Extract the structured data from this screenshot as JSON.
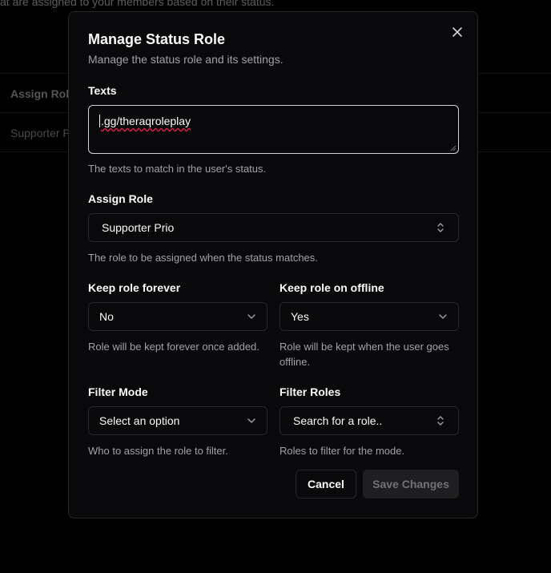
{
  "background": {
    "description_text": "at are assigned to your members based on their status.",
    "column_header": "Assign Role",
    "row_value": "Supporter P"
  },
  "modal": {
    "title": "Manage Status Role",
    "subtitle": "Manage the status role and its settings.",
    "close_icon": "x-icon",
    "texts": {
      "label": "Texts",
      "value": ".gg/theraqroleplay",
      "help": "The texts to match in the user's status."
    },
    "assign_role": {
      "label": "Assign Role",
      "value": "Supporter Prio",
      "help": "The role to be assigned when the status matches.",
      "icon": "chevrons-up-down-icon"
    },
    "keep_forever": {
      "label": "Keep role forever",
      "value": "No",
      "help": "Role will be kept forever once added.",
      "icon": "chevron-down-icon"
    },
    "keep_offline": {
      "label": "Keep role on offline",
      "value": "Yes",
      "help": "Role will be kept when the user goes offline.",
      "icon": "chevron-down-icon"
    },
    "filter_mode": {
      "label": "Filter Mode",
      "value": "Select an option",
      "help": "Who to assign the role to filter.",
      "icon": "chevron-down-icon"
    },
    "filter_roles": {
      "label": "Filter Roles",
      "value": "Search for a role..",
      "help": "Roles to filter for the mode.",
      "icon": "chevrons-up-down-icon"
    },
    "buttons": {
      "cancel": "Cancel",
      "save": "Save Changes"
    }
  },
  "colors": {
    "background": "#000000",
    "modal_bg": "#09090b",
    "border": "#27272a",
    "muted_text": "#a1a1aa",
    "spellcheck": "#e11d48"
  }
}
